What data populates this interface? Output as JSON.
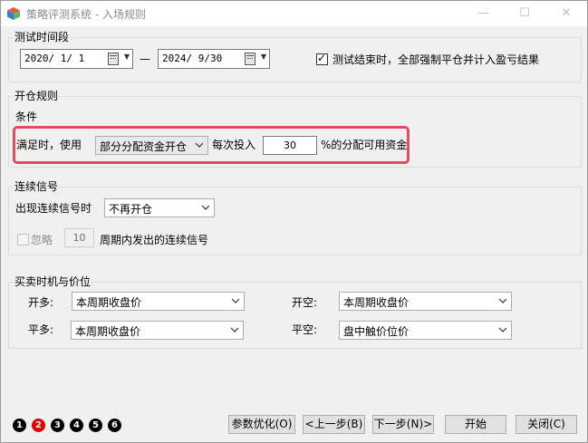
{
  "window": {
    "title": "策略评测系统 - 入场规则",
    "minimize": "—",
    "maximize": "☐",
    "close": "✕"
  },
  "test_period": {
    "group_title": "测试时间段",
    "start_date": "2020/ 1/ 1",
    "separator": "—",
    "end_date": "2024/ 9/30",
    "force_close_checked": true,
    "force_close_label": "测试结束时，全部强制平仓并计入盈亏结果"
  },
  "open_rules": {
    "group_title": "开仓规则",
    "condition_label": "条件",
    "when_satisfied_label": "满足时，使用",
    "mode_value": "部分分配资金开仓",
    "per_invest_label": "每次投入",
    "percent_value": "30",
    "percent_suffix": "%的分配可用资金"
  },
  "consecutive": {
    "group_title": "连续信号",
    "appear_label": "出现连续信号时",
    "appear_value": "不再开仓",
    "ignore_checked": false,
    "ignore_label": "忽略",
    "ignore_period": "10",
    "ignore_suffix": "周期内发出的连续信号"
  },
  "timing": {
    "group_title": "买卖时机与价位",
    "open_long_label": "开多:",
    "open_long_value": "本周期收盘价",
    "open_short_label": "开空:",
    "open_short_value": "本周期收盘价",
    "close_long_label": "平多:",
    "close_long_value": "本周期收盘价",
    "close_short_label": "平空:",
    "close_short_value": "盘中触价位价"
  },
  "steps": [
    "1",
    "2",
    "3",
    "4",
    "5",
    "6"
  ],
  "active_step": 2,
  "buttons": {
    "optimize": "参数优化(O)",
    "prev": "<上一步(B)",
    "next": "下一步(N)>",
    "start": "开始",
    "close": "关闭(C)"
  },
  "colors": {
    "highlight": "#e54a64",
    "active_step": "#e00000"
  }
}
